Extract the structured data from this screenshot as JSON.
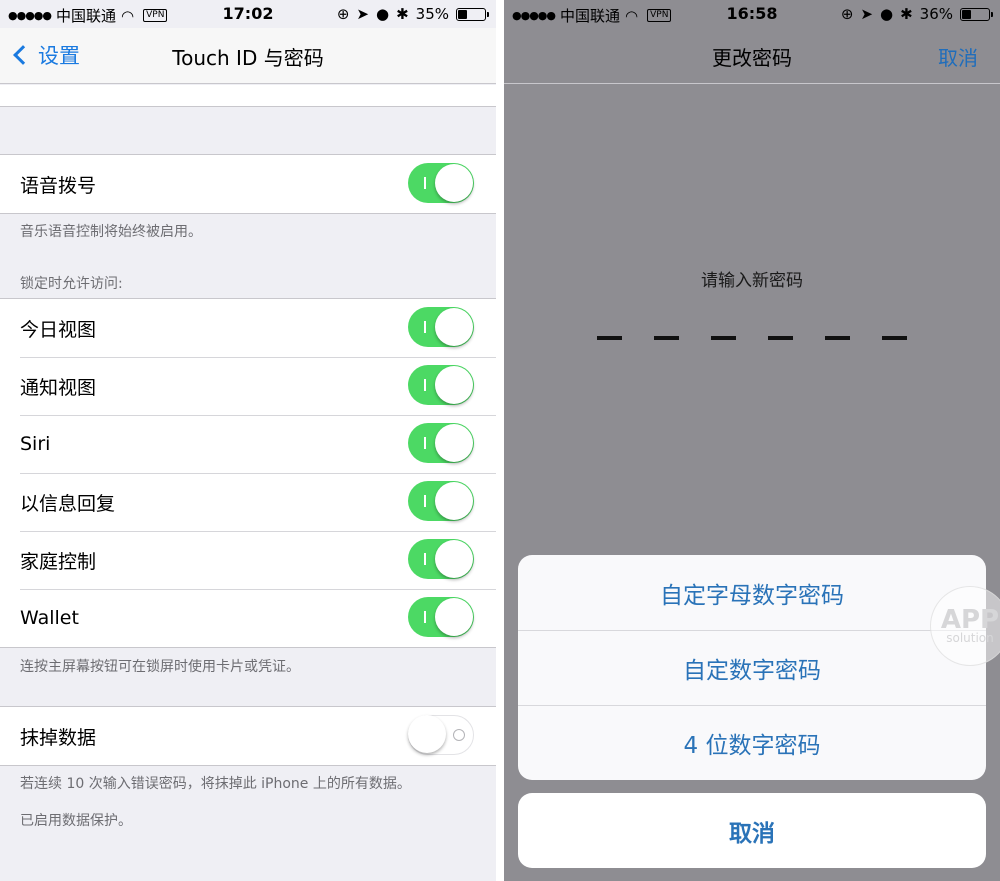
{
  "left_screen": {
    "status_bar": {
      "signal": "●●●●●",
      "carrier": "中国联通",
      "vpn": "VPN",
      "time": "17:02",
      "battery_percent": "35%",
      "battery_level": 0.35
    },
    "nav": {
      "back_label": "设置",
      "title": "Touch ID 与密码"
    },
    "voice_dial": {
      "label": "语音拨号",
      "on": true,
      "footnote": "音乐语音控制将始终被启用。"
    },
    "lock_access": {
      "header": "锁定时允许访问:",
      "items": [
        {
          "label": "今日视图",
          "on": true
        },
        {
          "label": "通知视图",
          "on": true
        },
        {
          "label": "Siri",
          "on": true
        },
        {
          "label": "以信息回复",
          "on": true
        },
        {
          "label": "家庭控制",
          "on": true
        },
        {
          "label": "Wallet",
          "on": true
        }
      ],
      "footnote": "连按主屏幕按钮可在锁屏时使用卡片或凭证。"
    },
    "erase_data": {
      "label": "抹掉数据",
      "on": false,
      "footnote_1": "若连续 10 次输入错误密码，将抹掉此 iPhone 上的所有数据。",
      "footnote_2": "已启用数据保护。"
    }
  },
  "right_screen": {
    "status_bar": {
      "signal": "●●●●●",
      "carrier": "中国联通",
      "vpn": "VPN",
      "time": "16:58",
      "battery_percent": "36%",
      "battery_level": 0.36
    },
    "nav": {
      "title": "更改密码",
      "cancel_label": "取消"
    },
    "prompt": "请输入新密码",
    "passcode_length": 6,
    "action_sheet": {
      "options": [
        "自定字母数字密码",
        "自定数字密码",
        "4 位数字密码"
      ],
      "cancel_label": "取消"
    },
    "watermark": {
      "line1": "APP",
      "line2": "solution"
    }
  },
  "colors": {
    "switch_on": "#4cd964",
    "ios_blue": "#1a7ae0",
    "group_bg": "#efeff4",
    "dim_overlay": "#8e8d92"
  }
}
